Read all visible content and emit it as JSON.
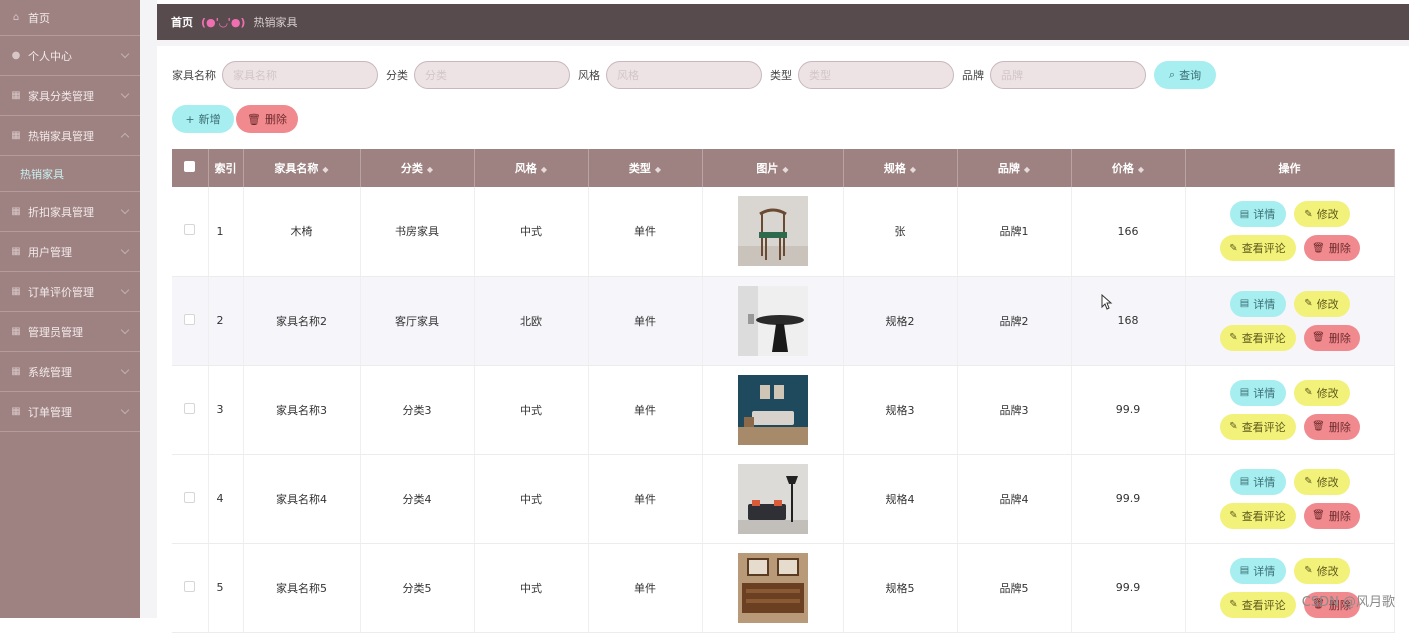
{
  "sidebar": {
    "items": [
      {
        "label": "首页",
        "icon": "home-icon"
      },
      {
        "label": "个人中心",
        "icon": "user-icon"
      },
      {
        "label": "家具分类管理",
        "icon": "grid-icon"
      },
      {
        "label": "热销家具管理",
        "icon": "grid-icon"
      },
      {
        "label": "热销家具",
        "icon": ""
      },
      {
        "label": "折扣家具管理",
        "icon": "grid-icon"
      },
      {
        "label": "用户管理",
        "icon": "grid-icon"
      },
      {
        "label": "订单评价管理",
        "icon": "grid-icon"
      },
      {
        "label": "管理员管理",
        "icon": "grid-icon"
      },
      {
        "label": "系统管理",
        "icon": "grid-icon"
      },
      {
        "label": "订单管理",
        "icon": "grid-icon"
      }
    ]
  },
  "breadcrumb": {
    "home": "首页",
    "face": "(●'◡'●)",
    "current": "热销家具"
  },
  "search": {
    "fields": [
      {
        "label": "家具名称",
        "placeholder": "家具名称"
      },
      {
        "label": "分类",
        "placeholder": "分类"
      },
      {
        "label": "风格",
        "placeholder": "风格"
      },
      {
        "label": "类型",
        "placeholder": "类型"
      },
      {
        "label": "品牌",
        "placeholder": "品牌"
      }
    ],
    "query_label": "查询"
  },
  "toolbar": {
    "add_label": "新增",
    "delete_label": "删除"
  },
  "table": {
    "headers": [
      "索引",
      "家具名称",
      "分类",
      "风格",
      "类型",
      "图片",
      "规格",
      "品牌",
      "价格",
      "操作"
    ],
    "rows": [
      {
        "index": "1",
        "name": "木椅",
        "category": "书房家具",
        "style": "中式",
        "type": "单件",
        "spec": "张",
        "brand": "品牌1",
        "price": "166"
      },
      {
        "index": "2",
        "name": "家具名称2",
        "category": "客厅家具",
        "style": "北欧",
        "type": "单件",
        "spec": "规格2",
        "brand": "品牌2",
        "price": "168"
      },
      {
        "index": "3",
        "name": "家具名称3",
        "category": "分类3",
        "style": "中式",
        "type": "单件",
        "spec": "规格3",
        "brand": "品牌3",
        "price": "99.9"
      },
      {
        "index": "4",
        "name": "家具名称4",
        "category": "分类4",
        "style": "中式",
        "type": "单件",
        "spec": "规格4",
        "brand": "品牌4",
        "price": "99.9"
      },
      {
        "index": "5",
        "name": "家具名称5",
        "category": "分类5",
        "style": "中式",
        "type": "单件",
        "spec": "规格5",
        "brand": "品牌5",
        "price": "99.9"
      }
    ],
    "ops": {
      "detail": "详情",
      "edit": "修改",
      "review": "查看评论",
      "delete": "删除"
    }
  },
  "watermark": "CSDN @风月歌"
}
